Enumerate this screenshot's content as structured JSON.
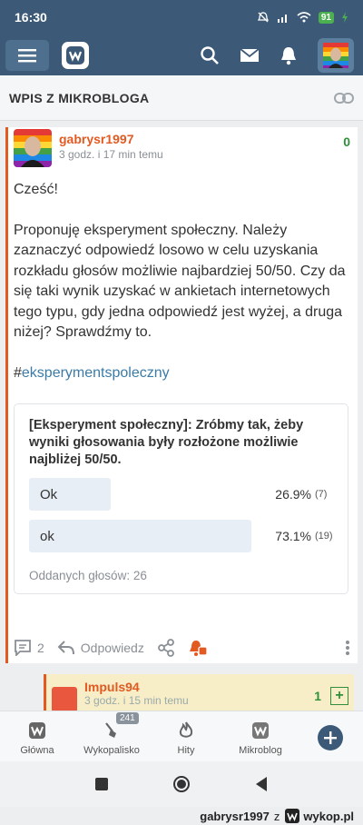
{
  "status_bar": {
    "time": "16:30",
    "battery": "91"
  },
  "header": {
    "title": "WPIS Z MIKROBLOGA"
  },
  "post": {
    "author": "gabrysr1997",
    "time_ago": "3 godz. i 17 min temu",
    "votes": "0",
    "paragraphs": [
      "Cześć!",
      "Proponuję eksperyment społeczny. Należy zaznaczyć odpowiedź losowo w celu uzyskania rozkładu głosów możliwie najbardziej 50/50. Czy da się taki wynik uzyskać w ankietach internetowych tego typu, gdy jedna odpowiedź jest wyżej, a druga niżej? Sprawdźmy to."
    ],
    "hashtag_prefix": "#",
    "hashtag": "eksperymentspoleczny",
    "poll": {
      "question": "[Eksperyment społeczny]: Zróbmy tak, żeby wyniki głosowania były rozłożone możliwie najbliżej 50/50.",
      "options": [
        {
          "label": "Ok",
          "percent": "26.9%",
          "count": "(7)",
          "fraction": 0.269
        },
        {
          "label": "ok",
          "percent": "73.1%",
          "count": "(19)",
          "fraction": 0.731
        }
      ],
      "total": "Oddanych głosów: 26"
    },
    "comments_count": "2",
    "reply_label": "Odpowiedz"
  },
  "reply": {
    "author": "Impuls94",
    "time_ago": "3 godz. i 15 min temu",
    "votes": "1"
  },
  "bottom_nav": {
    "items": [
      {
        "label": "Główna"
      },
      {
        "label": "Wykopalisko",
        "badge": "241"
      },
      {
        "label": "Hity"
      },
      {
        "label": "Mikroblog"
      }
    ]
  },
  "watermark": {
    "user": "gabrysr1997",
    "sep": "z",
    "site": "wykop.pl"
  },
  "colors": {
    "brand": "#3c5a78",
    "accent": "#e25a22",
    "positive": "#2f8f3a",
    "link": "#3b7ba6"
  }
}
